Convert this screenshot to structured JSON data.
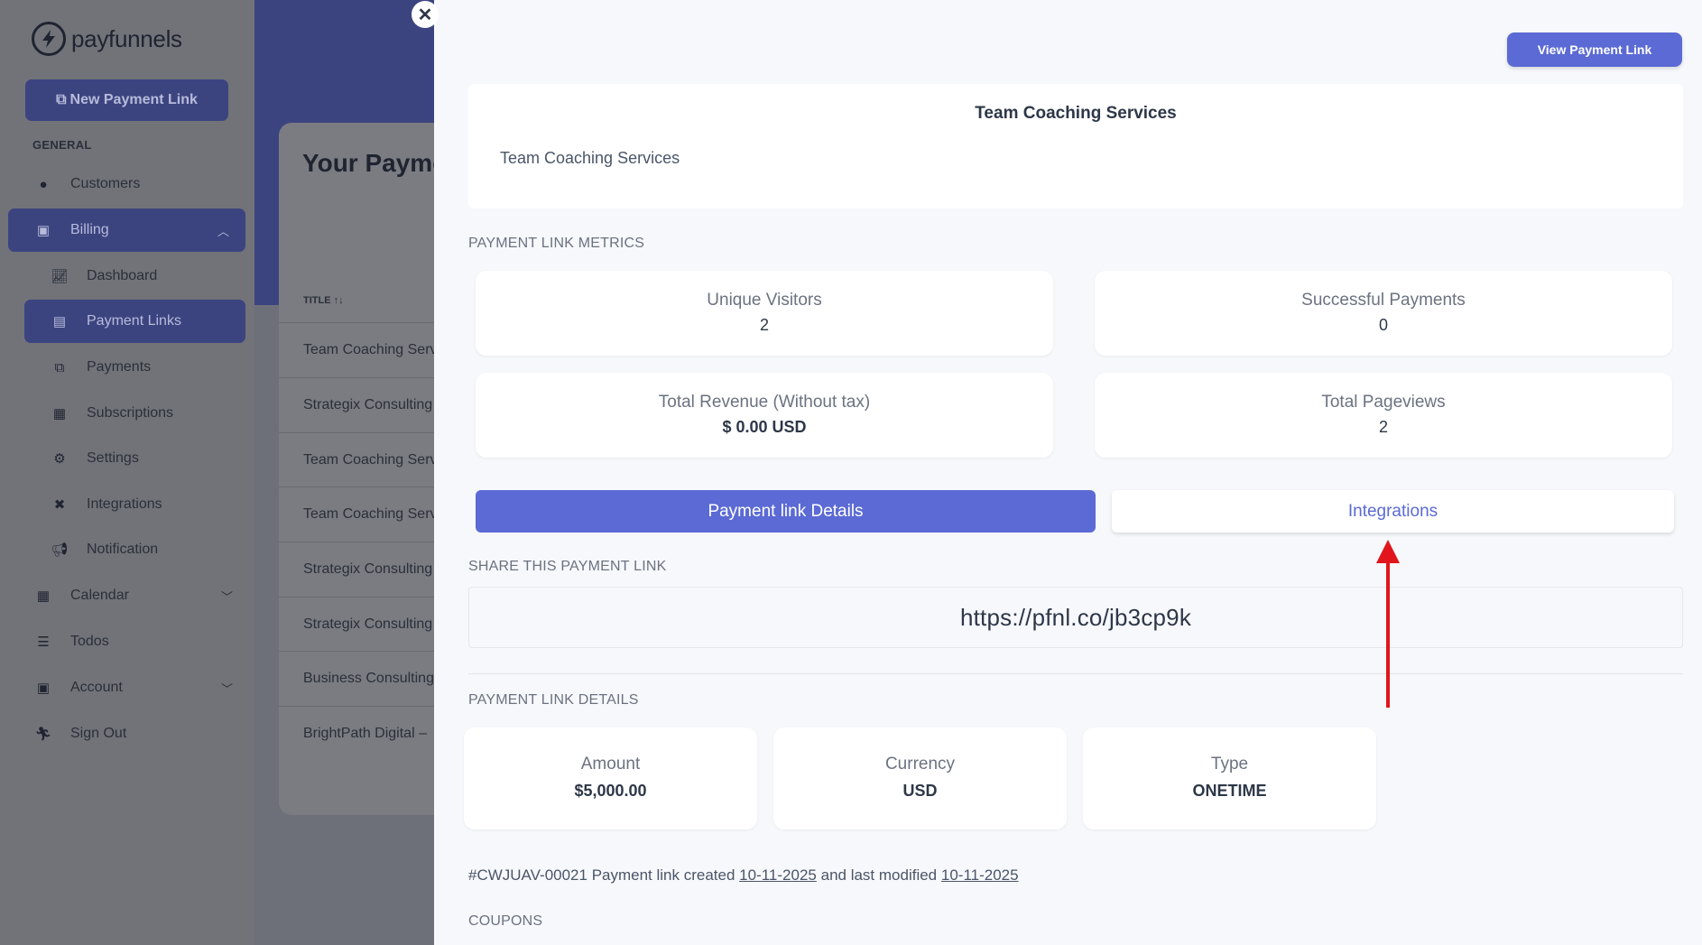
{
  "brand": {
    "name": "payfunnels"
  },
  "sidebar": {
    "new_button": "New Payment Link",
    "section": "GENERAL",
    "items": [
      {
        "label": "Customers",
        "icon": "user-icon"
      },
      {
        "label": "Billing",
        "icon": "money-icon",
        "expanded": true
      },
      {
        "label": "Dashboard",
        "icon": "chart-icon"
      },
      {
        "label": "Payment Links",
        "icon": "link-card-icon",
        "active": true
      },
      {
        "label": "Payments",
        "icon": "payments-icon"
      },
      {
        "label": "Subscriptions",
        "icon": "subscriptions-icon"
      },
      {
        "label": "Settings",
        "icon": "gear-icon"
      },
      {
        "label": "Integrations",
        "icon": "tools-icon"
      },
      {
        "label": "Notification",
        "icon": "megaphone-icon"
      },
      {
        "label": "Calendar",
        "icon": "calendar-icon"
      },
      {
        "label": "Todos",
        "icon": "list-icon"
      },
      {
        "label": "Account",
        "icon": "id-card-icon"
      },
      {
        "label": "Sign Out",
        "icon": "run-icon"
      }
    ]
  },
  "background": {
    "title": "Your Payme",
    "column": "TITLE",
    "rows": [
      "Team Coaching Serv",
      "Strategix Consulting",
      "Team Coaching Serv",
      "Team Coaching Serv",
      "Strategix Consulting",
      "Strategix Consulting",
      "Business Consulting",
      "BrightPath Digital –"
    ]
  },
  "drawer": {
    "view_button": "View Payment Link",
    "title": "Team Coaching Services",
    "subtitle": "Team Coaching Services",
    "metrics_label": "PAYMENT LINK METRICS",
    "metrics": {
      "unique_visitors": {
        "label": "Unique Visitors",
        "value": "2"
      },
      "successful_payments": {
        "label": "Successful Payments",
        "value": "0"
      },
      "total_revenue": {
        "label": "Total Revenue (Without tax)",
        "value": "$ 0.00 USD"
      },
      "total_pageviews": {
        "label": "Total Pageviews",
        "value": "2"
      }
    },
    "tabs": {
      "details": "Payment link Details",
      "integrations": "Integrations"
    },
    "share_label": "SHARE THIS PAYMENT LINK",
    "share_url": "https://pfnl.co/jb3cp9k",
    "details_label": "PAYMENT LINK DETAILS",
    "details": {
      "amount": {
        "label": "Amount",
        "value": "$5,000.00"
      },
      "currency": {
        "label": "Currency",
        "value": "USD"
      },
      "type": {
        "label": "Type",
        "value": "ONETIME"
      }
    },
    "meta": {
      "id_prefix": "#CWJUAV-00021 Payment link created",
      "created": "10-11-2025",
      "middle": "and last modified",
      "modified": "10-11-2025"
    },
    "coupons_label": "COUPONS"
  },
  "colors": {
    "accent": "#5b6ad4",
    "annotation": "#e0161c",
    "sidebar_active": "#3c4480"
  }
}
